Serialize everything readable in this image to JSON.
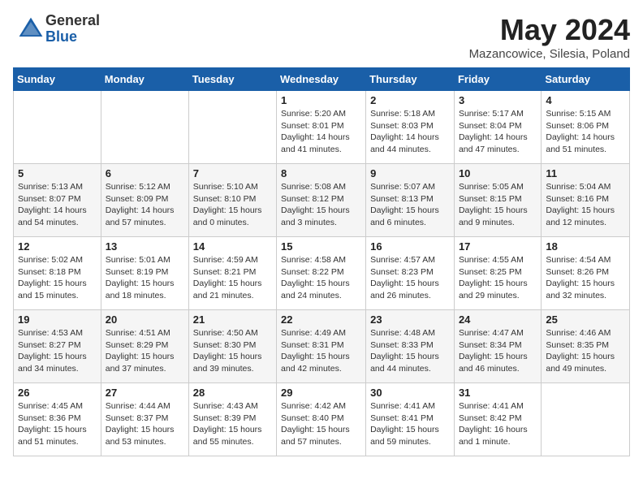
{
  "header": {
    "logo_general": "General",
    "logo_blue": "Blue",
    "month_title": "May 2024",
    "location": "Mazancowice, Silesia, Poland"
  },
  "days_of_week": [
    "Sunday",
    "Monday",
    "Tuesday",
    "Wednesday",
    "Thursday",
    "Friday",
    "Saturday"
  ],
  "weeks": [
    [
      {
        "day": "",
        "info": ""
      },
      {
        "day": "",
        "info": ""
      },
      {
        "day": "",
        "info": ""
      },
      {
        "day": "1",
        "info": "Sunrise: 5:20 AM\nSunset: 8:01 PM\nDaylight: 14 hours and 41 minutes."
      },
      {
        "day": "2",
        "info": "Sunrise: 5:18 AM\nSunset: 8:03 PM\nDaylight: 14 hours and 44 minutes."
      },
      {
        "day": "3",
        "info": "Sunrise: 5:17 AM\nSunset: 8:04 PM\nDaylight: 14 hours and 47 minutes."
      },
      {
        "day": "4",
        "info": "Sunrise: 5:15 AM\nSunset: 8:06 PM\nDaylight: 14 hours and 51 minutes."
      }
    ],
    [
      {
        "day": "5",
        "info": "Sunrise: 5:13 AM\nSunset: 8:07 PM\nDaylight: 14 hours and 54 minutes."
      },
      {
        "day": "6",
        "info": "Sunrise: 5:12 AM\nSunset: 8:09 PM\nDaylight: 14 hours and 57 minutes."
      },
      {
        "day": "7",
        "info": "Sunrise: 5:10 AM\nSunset: 8:10 PM\nDaylight: 15 hours and 0 minutes."
      },
      {
        "day": "8",
        "info": "Sunrise: 5:08 AM\nSunset: 8:12 PM\nDaylight: 15 hours and 3 minutes."
      },
      {
        "day": "9",
        "info": "Sunrise: 5:07 AM\nSunset: 8:13 PM\nDaylight: 15 hours and 6 minutes."
      },
      {
        "day": "10",
        "info": "Sunrise: 5:05 AM\nSunset: 8:15 PM\nDaylight: 15 hours and 9 minutes."
      },
      {
        "day": "11",
        "info": "Sunrise: 5:04 AM\nSunset: 8:16 PM\nDaylight: 15 hours and 12 minutes."
      }
    ],
    [
      {
        "day": "12",
        "info": "Sunrise: 5:02 AM\nSunset: 8:18 PM\nDaylight: 15 hours and 15 minutes."
      },
      {
        "day": "13",
        "info": "Sunrise: 5:01 AM\nSunset: 8:19 PM\nDaylight: 15 hours and 18 minutes."
      },
      {
        "day": "14",
        "info": "Sunrise: 4:59 AM\nSunset: 8:21 PM\nDaylight: 15 hours and 21 minutes."
      },
      {
        "day": "15",
        "info": "Sunrise: 4:58 AM\nSunset: 8:22 PM\nDaylight: 15 hours and 24 minutes."
      },
      {
        "day": "16",
        "info": "Sunrise: 4:57 AM\nSunset: 8:23 PM\nDaylight: 15 hours and 26 minutes."
      },
      {
        "day": "17",
        "info": "Sunrise: 4:55 AM\nSunset: 8:25 PM\nDaylight: 15 hours and 29 minutes."
      },
      {
        "day": "18",
        "info": "Sunrise: 4:54 AM\nSunset: 8:26 PM\nDaylight: 15 hours and 32 minutes."
      }
    ],
    [
      {
        "day": "19",
        "info": "Sunrise: 4:53 AM\nSunset: 8:27 PM\nDaylight: 15 hours and 34 minutes."
      },
      {
        "day": "20",
        "info": "Sunrise: 4:51 AM\nSunset: 8:29 PM\nDaylight: 15 hours and 37 minutes."
      },
      {
        "day": "21",
        "info": "Sunrise: 4:50 AM\nSunset: 8:30 PM\nDaylight: 15 hours and 39 minutes."
      },
      {
        "day": "22",
        "info": "Sunrise: 4:49 AM\nSunset: 8:31 PM\nDaylight: 15 hours and 42 minutes."
      },
      {
        "day": "23",
        "info": "Sunrise: 4:48 AM\nSunset: 8:33 PM\nDaylight: 15 hours and 44 minutes."
      },
      {
        "day": "24",
        "info": "Sunrise: 4:47 AM\nSunset: 8:34 PM\nDaylight: 15 hours and 46 minutes."
      },
      {
        "day": "25",
        "info": "Sunrise: 4:46 AM\nSunset: 8:35 PM\nDaylight: 15 hours and 49 minutes."
      }
    ],
    [
      {
        "day": "26",
        "info": "Sunrise: 4:45 AM\nSunset: 8:36 PM\nDaylight: 15 hours and 51 minutes."
      },
      {
        "day": "27",
        "info": "Sunrise: 4:44 AM\nSunset: 8:37 PM\nDaylight: 15 hours and 53 minutes."
      },
      {
        "day": "28",
        "info": "Sunrise: 4:43 AM\nSunset: 8:39 PM\nDaylight: 15 hours and 55 minutes."
      },
      {
        "day": "29",
        "info": "Sunrise: 4:42 AM\nSunset: 8:40 PM\nDaylight: 15 hours and 57 minutes."
      },
      {
        "day": "30",
        "info": "Sunrise: 4:41 AM\nSunset: 8:41 PM\nDaylight: 15 hours and 59 minutes."
      },
      {
        "day": "31",
        "info": "Sunrise: 4:41 AM\nSunset: 8:42 PM\nDaylight: 16 hours and 1 minute."
      },
      {
        "day": "",
        "info": ""
      }
    ]
  ]
}
